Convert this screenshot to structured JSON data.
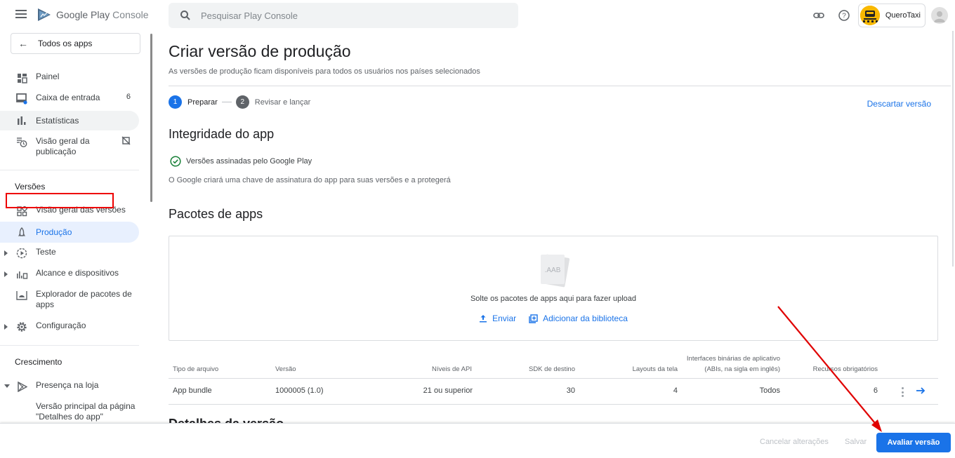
{
  "header": {
    "brand_google_play": "Google Play",
    "brand_console": "Console",
    "search_placeholder": "Pesquisar Play Console",
    "app_name": "QueroTaxi"
  },
  "sidebar": {
    "back_label": "Todos os apps",
    "items": [
      {
        "label": "Painel",
        "icon": "dashboard-icon"
      },
      {
        "label": "Caixa de entrada",
        "icon": "inbox-icon",
        "badge": "6"
      },
      {
        "label": "Estatísticas",
        "icon": "bar-chart-icon"
      },
      {
        "label": "Visão geral da publicação",
        "icon": "publishing-overview-icon"
      }
    ],
    "section_versoes": "Versões",
    "versoes_items": [
      {
        "label": "Visão geral das versões",
        "icon": "releases-overview-icon"
      },
      {
        "label": "Produção",
        "icon": "rocket-icon",
        "active": true
      },
      {
        "label": "Teste",
        "icon": "testing-icon"
      },
      {
        "label": "Alcance e dispositivos",
        "icon": "reach-devices-icon"
      },
      {
        "label": "Explorador de pacotes de apps",
        "icon": "bundle-explorer-icon"
      },
      {
        "label": "Configuração",
        "icon": "gear-icon"
      }
    ],
    "section_crescimento": "Crescimento",
    "crescimento_items": [
      {
        "label": "Presença na loja",
        "icon": "play-store-icon"
      },
      {
        "label": "Versão principal da página \"Detalhes do app\""
      }
    ]
  },
  "main": {
    "title": "Criar versão de produção",
    "subtitle": "As versões de produção ficam disponíveis para todos os usuários nos países selecionados",
    "steps": [
      {
        "number": "1",
        "label": "Preparar"
      },
      {
        "number": "2",
        "label": "Revisar e lançar"
      }
    ],
    "discard_label": "Descartar versão",
    "integrity": {
      "title": "Integridade do app",
      "status": "Versões assinadas pelo Google Play",
      "description": "O Google criará uma chave de assinatura do app para suas versões e a protegerá"
    },
    "bundles": {
      "title": "Pacotes de apps",
      "file_badge": ".AAB",
      "drop_text": "Solte os pacotes de apps aqui para fazer upload",
      "upload_label": "Enviar",
      "library_label": "Adicionar da biblioteca"
    },
    "table": {
      "headers": {
        "file_type": "Tipo de arquivo",
        "version": "Versão",
        "api_levels": "Níveis de API",
        "target_sdk": "SDK de destino",
        "screen_layouts": "Layouts da tela",
        "abis_line1": "Interfaces binárias de aplicativo",
        "abis_line2": "(ABIs, na sigla em inglês)",
        "required_features": "Recursos obrigatórios"
      },
      "rows": [
        {
          "file_type": "App bundle",
          "version": "1000005 (1.0)",
          "api_levels": "21 ou superior",
          "target_sdk": "30",
          "screen_layouts": "4",
          "abis": "Todos",
          "required_features": "6"
        }
      ]
    },
    "next_section_title": "Detalhes da versão"
  },
  "footer": {
    "cancel_label": "Cancelar alterações",
    "save_label": "Salvar",
    "review_label": "Avaliar versão"
  },
  "colors": {
    "accent": "#1a73e8",
    "annotation": "#e00000",
    "success": "#188038"
  }
}
